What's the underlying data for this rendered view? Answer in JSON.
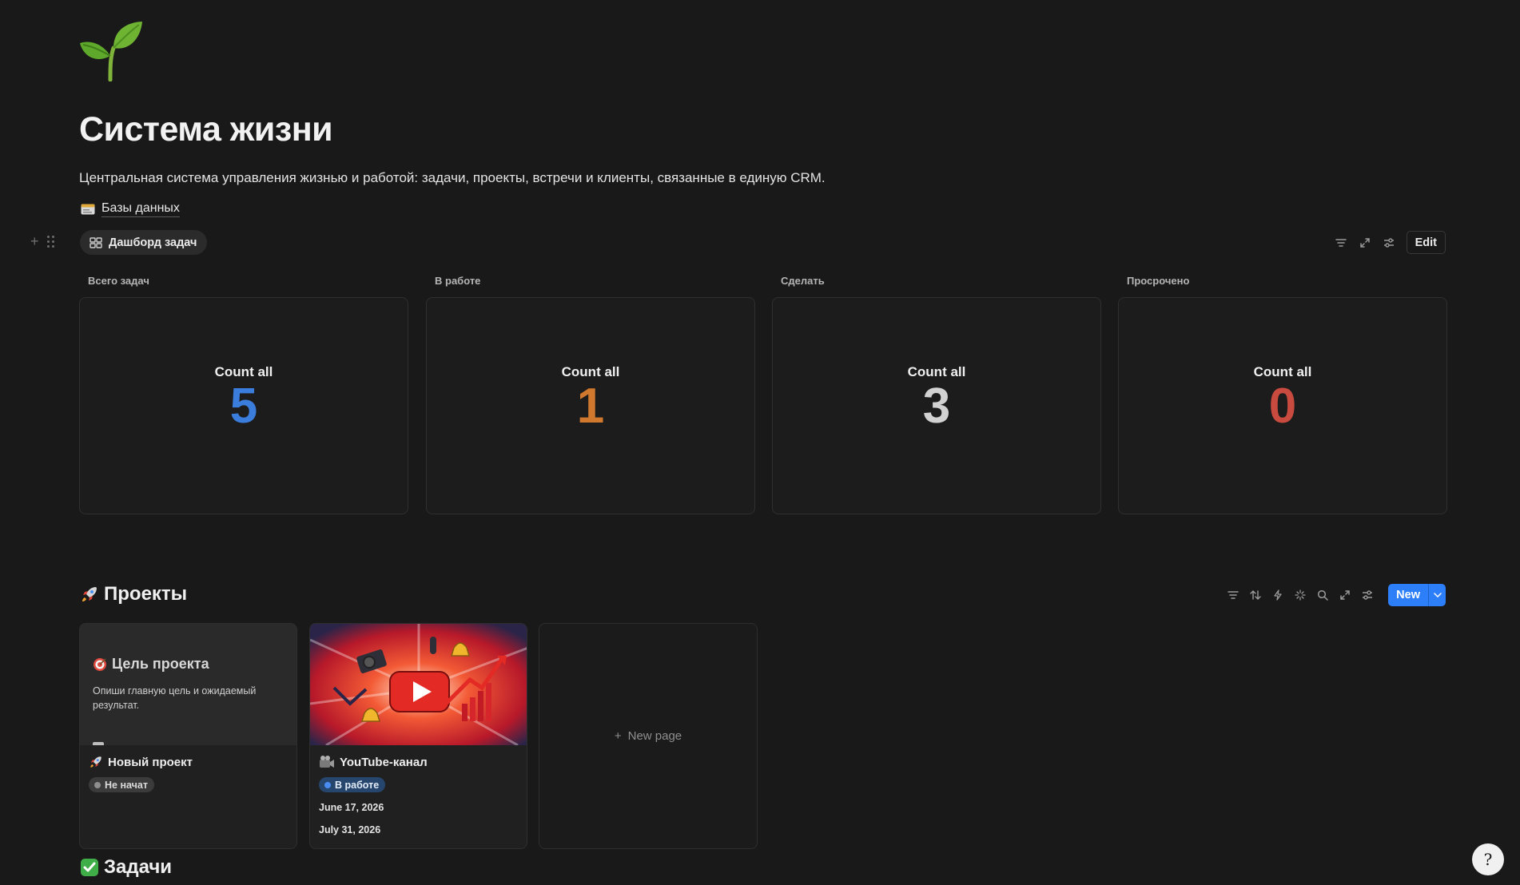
{
  "page": {
    "icon": "seedling-icon",
    "title": "Система жизни",
    "description": "Центральная система управления жизнью и работой: задачи, проекты, встречи и клиенты, связанные в единую CRM.",
    "db_link": "Базы данных"
  },
  "dashboard": {
    "tab_label": "Дашборд задач",
    "edit_label": "Edit",
    "stats": [
      {
        "label": "Всего задач",
        "count_label": "Count all",
        "value": "5",
        "color": "#3b7ddd"
      },
      {
        "label": "В работе",
        "count_label": "Count all",
        "value": "1",
        "color": "#d0782d"
      },
      {
        "label": "Сделать",
        "count_label": "Count all",
        "value": "3",
        "color": "#d2d2d2"
      },
      {
        "label": "Просрочено",
        "count_label": "Count all",
        "value": "0",
        "color": "#c94b3f"
      }
    ]
  },
  "projects": {
    "title": "Проекты",
    "new_label": "New",
    "cards": [
      {
        "cover_heading": "Цель проекта",
        "cover_text": "Опиши главную цель и ожидаемый результат.",
        "name": "Новый проект",
        "status": "Не начат"
      },
      {
        "name": "YouTube-канал",
        "status": "В работе",
        "date_start": "June 17, 2026",
        "date_end": "July 31, 2026"
      }
    ],
    "new_page_label": "New page"
  },
  "tasks": {
    "title": "Задачи"
  },
  "help": {
    "label": "?"
  }
}
